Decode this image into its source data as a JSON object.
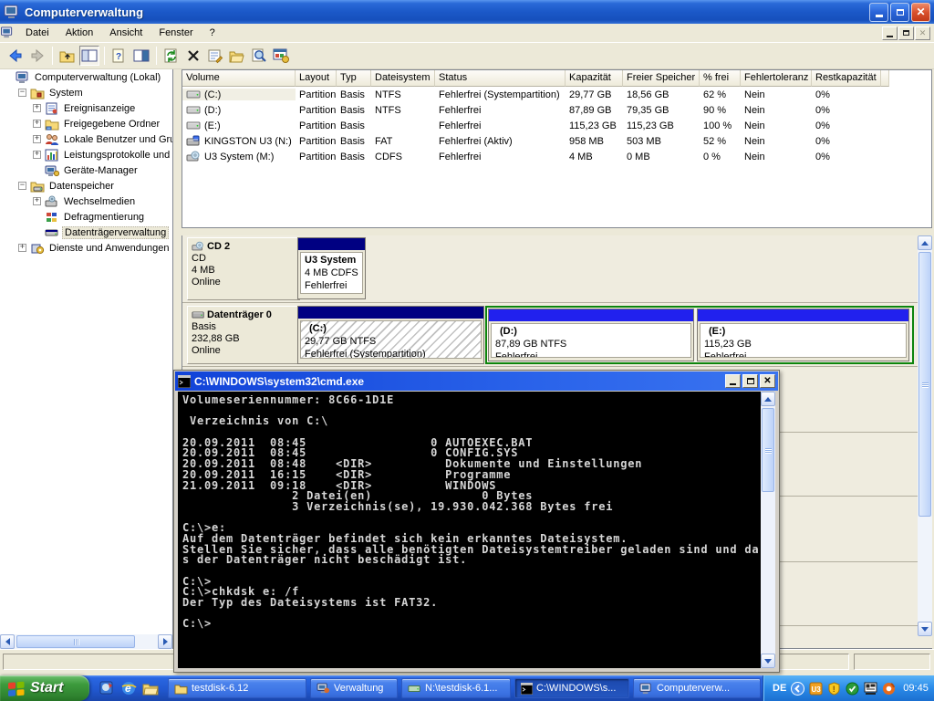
{
  "window": {
    "title": "Computerverwaltung",
    "menus": [
      "Datei",
      "Aktion",
      "Ansicht",
      "Fenster",
      "?"
    ],
    "toolbar_icons": [
      "back",
      "forward",
      "up-level",
      "show-hide-tree",
      "export-list",
      "show-pane",
      "refresh",
      "delete",
      "properties",
      "open-folder",
      "view",
      "disk-settings"
    ]
  },
  "tree": {
    "items": [
      {
        "label": "Computerverwaltung (Lokal)",
        "icon": "computer-icon",
        "selected": false
      },
      {
        "label": "System",
        "icon": "system-tools-icon",
        "expander": "-"
      },
      {
        "label": "Ereignisanzeige",
        "icon": "event-viewer-icon",
        "expander": "+"
      },
      {
        "label": "Freigegebene Ordner",
        "icon": "shared-folders-icon",
        "expander": "+"
      },
      {
        "label": "Lokale Benutzer und Gruppen",
        "icon": "local-users-icon",
        "expander": "+"
      },
      {
        "label": "Leistungsprotokolle und Warnungen",
        "icon": "performance-logs-icon",
        "expander": "+"
      },
      {
        "label": "Geräte-Manager",
        "icon": "device-manager-icon"
      },
      {
        "label": "Datenspeicher",
        "icon": "storage-icon",
        "expander": "-"
      },
      {
        "label": "Wechselmedien",
        "icon": "removable-media-icon",
        "expander": "+"
      },
      {
        "label": "Defragmentierung",
        "icon": "defrag-icon"
      },
      {
        "label": "Datenträgerverwaltung",
        "icon": "disk-management-icon",
        "selected": true
      },
      {
        "label": "Dienste und Anwendungen",
        "icon": "services-icon",
        "expander": "+"
      }
    ]
  },
  "volume_table": {
    "columns": [
      "Volume",
      "Layout",
      "Typ",
      "Dateisystem",
      "Status",
      "Kapazität",
      "Freier Speicher",
      "% frei",
      "Fehlertoleranz",
      "Restkapazität"
    ],
    "rows": [
      {
        "icon": "drive-icon",
        "cells": [
          "(C:)",
          "Partition",
          "Basis",
          "NTFS",
          "Fehlerfrei (Systempartition)",
          "29,77 GB",
          "18,56 GB",
          "62 %",
          "Nein",
          "0%"
        ]
      },
      {
        "icon": "drive-icon",
        "cells": [
          "(D:)",
          "Partition",
          "Basis",
          "NTFS",
          "Fehlerfrei",
          "87,89 GB",
          "79,35 GB",
          "90 %",
          "Nein",
          "0%"
        ]
      },
      {
        "icon": "drive-icon",
        "cells": [
          "(E:)",
          "Partition",
          "Basis",
          "",
          "Fehlerfrei",
          "115,23 GB",
          "115,23 GB",
          "100 %",
          "Nein",
          "0%"
        ]
      },
      {
        "icon": "usb-drive-icon",
        "cells": [
          "KINGSTON U3 (N:)",
          "Partition",
          "Basis",
          "FAT",
          "Fehlerfrei (Aktiv)",
          "958 MB",
          "503 MB",
          "52 %",
          "Nein",
          "0%"
        ]
      },
      {
        "icon": "cd-drive-icon",
        "cells": [
          "U3 System (M:)",
          "Partition",
          "Basis",
          "CDFS",
          "Fehlerfrei",
          "4 MB",
          "0 MB",
          "0 %",
          "Nein",
          "0%"
        ]
      }
    ]
  },
  "disks": [
    {
      "icon": "cd-drive-icon",
      "name": "CD 2",
      "line1": "CD",
      "line2": "4 MB",
      "line3": "Online",
      "partitions": [
        {
          "label": "U3 System",
          "size_fs": "4 MB CDFS",
          "status": "Fehlerfrei",
          "band": "primary"
        }
      ]
    },
    {
      "icon": "hard-disk-icon",
      "name": "Datenträger 0",
      "line1": "Basis",
      "line2": "232,88 GB",
      "line3": "Online",
      "partitions": [
        {
          "label": "(C:)",
          "size_fs": "29,77 GB NTFS",
          "status": "Fehlerfrei (Systempartition)",
          "band": "primary",
          "selected": true
        },
        {
          "label": "(D:)",
          "size_fs": "87,89 GB NTFS",
          "status": "Fehlerfrei",
          "band": "logical"
        },
        {
          "label": "(E:)",
          "size_fs": "115,23 GB",
          "status": "Fehlerfrei",
          "band": "logical"
        }
      ]
    }
  ],
  "legend_colors": {
    "primary_partition_band": "#000082",
    "logical_drive_band": "#2121ee",
    "extended_partition_border": "#0c840c"
  },
  "cmd": {
    "title": "C:\\WINDOWS\\system32\\cmd.exe",
    "lines": [
      "Volumeseriennummer: 8C66-1D1E",
      "",
      " Verzeichnis von C:\\",
      "",
      "20.09.2011  08:45                 0 AUTOEXEC.BAT",
      "20.09.2011  08:45                 0 CONFIG.SYS",
      "20.09.2011  08:48    <DIR>          Dokumente und Einstellungen",
      "20.09.2011  16:15    <DIR>          Programme",
      "21.09.2011  09:18    <DIR>          WINDOWS",
      "               2 Datei(en)               0 Bytes",
      "               3 Verzeichnis(se), 19.930.042.368 Bytes frei",
      "",
      "C:\\>e:",
      "Auf dem Datenträger befindet sich kein erkanntes Dateisystem.",
      "Stellen Sie sicher, dass alle benötigten Dateisystemtreiber geladen sind und das",
      "s der Datenträger nicht beschädigt ist.",
      "",
      "C:\\>",
      "C:\\>chkdsk e: /f",
      "Der Typ des Dateisystems ist FAT32.",
      "",
      "C:\\>"
    ]
  },
  "taskbar": {
    "start_label": "Start",
    "quick_launch_icons": [
      "application-icon",
      "internet-explorer-icon",
      "windows-explorer-icon"
    ],
    "buttons": [
      {
        "label": "testdisk-6.12",
        "icon": "folder-icon",
        "active": false
      },
      {
        "label": "Verwaltung",
        "icon": "mmc-icon",
        "active": false
      },
      {
        "label": "N:\\testdisk-6.1...",
        "icon": "drive-icon",
        "active": false
      },
      {
        "label": "C:\\WINDOWS\\s...",
        "icon": "cmd-icon",
        "active": true
      },
      {
        "label": "Computerverw...",
        "icon": "computer-icon",
        "active": false
      }
    ],
    "tray": {
      "language": "DE",
      "icons": [
        "chevron-left-icon",
        "u3-icon",
        "security-shield-icon",
        "antivirus-check-icon",
        "network-adapter-icon",
        "updater-ring-icon"
      ],
      "time": "09:45"
    }
  }
}
